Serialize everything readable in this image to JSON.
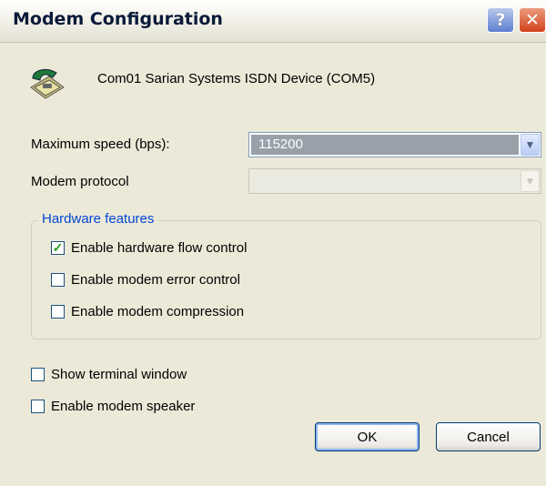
{
  "window": {
    "title": "Modem Configuration",
    "help_label": "?",
    "close_label": "✕"
  },
  "device": {
    "icon": "telephone-icon",
    "name": "Com01 Sarian Systems ISDN Device (COM5)"
  },
  "speed": {
    "label": "Maximum speed (bps):",
    "value": "115200"
  },
  "protocol": {
    "label": "Modem protocol",
    "value": ""
  },
  "hardware": {
    "legend": "Hardware features",
    "options": [
      {
        "label": "Enable hardware flow control",
        "checked": true
      },
      {
        "label": "Enable modem error control",
        "checked": false
      },
      {
        "label": "Enable modem compression",
        "checked": false
      }
    ]
  },
  "extra": {
    "options": [
      {
        "label": "Show terminal window",
        "checked": false
      },
      {
        "label": "Enable modem speaker",
        "checked": false
      }
    ]
  },
  "buttons": {
    "ok": "OK",
    "cancel": "Cancel"
  },
  "colors": {
    "accent": "#0046d5",
    "check": "#21a121",
    "selection": "#98a0aa"
  }
}
